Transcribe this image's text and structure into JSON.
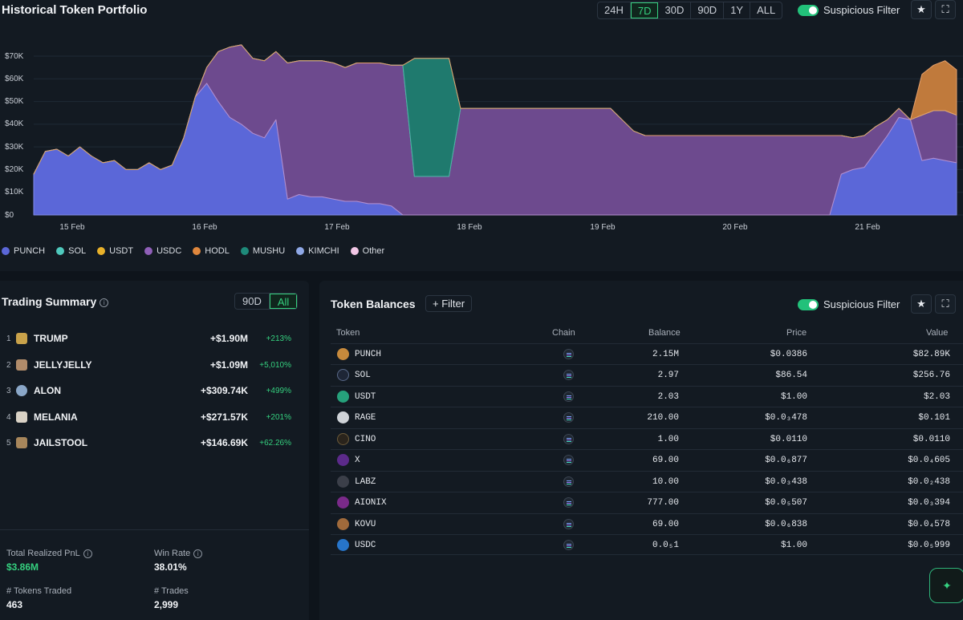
{
  "chart": {
    "title": "Historical Token Portfolio",
    "ranges": [
      "24H",
      "7D",
      "30D",
      "90D",
      "1Y",
      "ALL"
    ],
    "active_range": "7D",
    "suspicious_filter_label": "Suspicious Filter",
    "y_ticks": [
      "$70K",
      "$60K",
      "$50K",
      "$40K",
      "$30K",
      "$20K",
      "$10K",
      "$0"
    ],
    "x_ticks": [
      "15 Feb",
      "16 Feb",
      "17 Feb",
      "18 Feb",
      "19 Feb",
      "20 Feb",
      "21 Feb"
    ],
    "legend": [
      {
        "label": "PUNCH",
        "color": "#5b67d8"
      },
      {
        "label": "SOL",
        "color": "#4fc9bd"
      },
      {
        "label": "USDT",
        "color": "#e8b12a"
      },
      {
        "label": "USDC",
        "color": "#8f5fb8"
      },
      {
        "label": "HODL",
        "color": "#e0873d"
      },
      {
        "label": "MUSHU",
        "color": "#1e8a7a"
      },
      {
        "label": "KIMCHI",
        "color": "#8fa8e6"
      },
      {
        "label": "Other",
        "color": "#f2c7e6"
      }
    ]
  },
  "chart_data": {
    "type": "area",
    "x": [
      0,
      0.5,
      1,
      1.5,
      2,
      2.5,
      3,
      3.5,
      4,
      4.5,
      5,
      5.5,
      6,
      6.5,
      7,
      7.5,
      8,
      8.5,
      9,
      9.5,
      10,
      10.5,
      11,
      11.5,
      12,
      12.5,
      13,
      13.5,
      14,
      14.5,
      15,
      15.5,
      16,
      16.5,
      17,
      17.5,
      18,
      18.5,
      19,
      19.5,
      20,
      20.5,
      21,
      21.5,
      22,
      22.5,
      23,
      23.5,
      24,
      24.5,
      25,
      25.5,
      26,
      26.5,
      27,
      27.5,
      28,
      28.5,
      29,
      29.5,
      30,
      30.5,
      31,
      31.5,
      32,
      32.5,
      33,
      33.5,
      34,
      34.5,
      35,
      35.5,
      36,
      36.5,
      37,
      37.5,
      38,
      38.5,
      39,
      39.5,
      40
    ],
    "x_unit": "position within 7D window (Feb 14 → Feb 21)",
    "series": [
      {
        "name": "PUNCH",
        "values": [
          18,
          28,
          29,
          26,
          30,
          26,
          23,
          24,
          20,
          20,
          23,
          20,
          22,
          34,
          52,
          58,
          50,
          43,
          40,
          36,
          34,
          42,
          7,
          9,
          8,
          8,
          7,
          6,
          6,
          5,
          5,
          4,
          0,
          0,
          0,
          0,
          0,
          0,
          0,
          0,
          0,
          0,
          0,
          0,
          0,
          0,
          0,
          0,
          0,
          0,
          0,
          0,
          0,
          0,
          0,
          0,
          0,
          0,
          0,
          0,
          0,
          0,
          0,
          0,
          0,
          0,
          0,
          0,
          0,
          0,
          18,
          20,
          21,
          28,
          35,
          43,
          42,
          24,
          25,
          24,
          23
        ]
      },
      {
        "name": "USDC",
        "values": [
          0,
          0,
          0,
          0,
          0,
          0,
          0,
          0,
          0,
          0,
          0,
          0,
          0,
          0,
          0,
          7,
          22,
          31,
          35,
          33,
          34,
          30,
          60,
          59,
          60,
          60,
          60,
          59,
          61,
          62,
          62,
          62,
          66,
          17,
          17,
          17,
          17,
          47,
          47,
          47,
          47,
          47,
          47,
          47,
          47,
          47,
          47,
          47,
          47,
          47,
          47,
          42,
          37,
          35,
          35,
          35,
          35,
          35,
          35,
          35,
          35,
          35,
          35,
          35,
          35,
          35,
          35,
          35,
          35,
          35,
          17,
          14,
          14,
          11,
          7,
          4,
          0,
          20,
          21,
          22,
          21
        ]
      },
      {
        "name": "MUSHU",
        "values": [
          0,
          0,
          0,
          0,
          0,
          0,
          0,
          0,
          0,
          0,
          0,
          0,
          0,
          0,
          0,
          0,
          0,
          0,
          0,
          0,
          0,
          0,
          0,
          0,
          0,
          0,
          0,
          0,
          0,
          0,
          0,
          0,
          0,
          52,
          52,
          52,
          52,
          0,
          0,
          0,
          0,
          0,
          0,
          0,
          0,
          0,
          0,
          0,
          0,
          0,
          0,
          0,
          0,
          0,
          0,
          0,
          0,
          0,
          0,
          0,
          0,
          0,
          0,
          0,
          0,
          0,
          0,
          0,
          0,
          0,
          0,
          0,
          0,
          0,
          0,
          0,
          0,
          0,
          0,
          0,
          0
        ]
      },
      {
        "name": "HODL",
        "values": [
          0,
          0,
          0,
          0,
          0,
          0,
          0,
          0,
          0,
          0,
          0,
          0,
          0,
          0,
          0,
          0,
          0,
          0,
          0,
          0,
          0,
          0,
          0,
          0,
          0,
          0,
          0,
          0,
          0,
          0,
          0,
          0,
          0,
          0,
          0,
          0,
          0,
          0,
          0,
          0,
          0,
          0,
          0,
          0,
          0,
          0,
          0,
          0,
          0,
          0,
          0,
          0,
          0,
          0,
          0,
          0,
          0,
          0,
          0,
          0,
          0,
          0,
          0,
          0,
          0,
          0,
          0,
          0,
          0,
          0,
          0,
          0,
          0,
          0,
          0,
          0,
          0,
          18,
          20,
          22,
          20
        ]
      }
    ],
    "ylim": [
      0,
      75
    ],
    "y_unit": "$K",
    "x_ticks": [
      "15 Feb",
      "16 Feb",
      "17 Feb",
      "18 Feb",
      "19 Feb",
      "20 Feb",
      "21 Feb"
    ],
    "y_ticks": [
      "$0",
      "$10K",
      "$20K",
      "$30K",
      "$40K",
      "$50K",
      "$60K",
      "$70K"
    ]
  },
  "trading": {
    "title": "Trading Summary",
    "toggle": [
      "90D",
      "All"
    ],
    "active_toggle": "All",
    "rows": [
      {
        "rank": "1",
        "name": "TRUMP",
        "pnl": "+$1.90M",
        "pct": "+213%",
        "color": "#c9a24a"
      },
      {
        "rank": "2",
        "name": "JELLYJELLY",
        "pnl": "+$1.09M",
        "pct": "+5,010%",
        "color": "#b08b6a"
      },
      {
        "rank": "3",
        "name": "ALON",
        "pnl": "+$309.74K",
        "pct": "+499%",
        "color": "#8aa7c8"
      },
      {
        "rank": "4",
        "name": "MELANIA",
        "pnl": "+$271.57K",
        "pct": "+201%",
        "color": "#d9d2c6"
      },
      {
        "rank": "5",
        "name": "JAILSTOOL",
        "pnl": "+$146.69K",
        "pct": "+62.26%",
        "color": "#a7865b"
      }
    ],
    "stats": {
      "realized_label": "Total Realized PnL",
      "realized_value": "$3.86M",
      "winrate_label": "Win Rate",
      "winrate_value": "38.01%",
      "tokens_label": "# Tokens Traded",
      "tokens_value": "463",
      "trades_label": "# Trades",
      "trades_value": "2,999"
    }
  },
  "balances": {
    "title": "Token Balances",
    "filter_label": "+ Filter",
    "suspicious_filter_label": "Suspicious Filter",
    "columns": [
      "Token",
      "Chain",
      "Balance",
      "Price",
      "Value"
    ],
    "rows": [
      {
        "token": "PUNCH",
        "balance": "2.15M",
        "price": "$0.0386",
        "value": "$82.89K",
        "color": "#c78a3c"
      },
      {
        "token": "SOL",
        "balance": "2.97",
        "price": "$86.54",
        "value": "$256.76",
        "color": "#1e2636"
      },
      {
        "token": "USDT",
        "balance": "2.03",
        "price": "$1.00",
        "value": "$2.03",
        "color": "#26a17b"
      },
      {
        "token": "RAGE",
        "balance": "210.00",
        "price": "$0.0₃478",
        "value": "$0.101",
        "color": "#cfd3d8"
      },
      {
        "token": "CINO",
        "balance": "1.00",
        "price": "$0.0110",
        "value": "$0.0110",
        "color": "#2a241c"
      },
      {
        "token": "X",
        "balance": "69.00",
        "price": "$0.0₆877",
        "value": "$0.0₄605",
        "color": "#5b2a8a"
      },
      {
        "token": "LABZ",
        "balance": "10.00",
        "price": "$0.0₃438",
        "value": "$0.0₂438",
        "color": "#3b3f49"
      },
      {
        "token": "AIONIX",
        "balance": "777.00",
        "price": "$0.0₅507",
        "value": "$0.0₃394",
        "color": "#7a2a8a"
      },
      {
        "token": "KOVU",
        "balance": "69.00",
        "price": "$0.0₆838",
        "value": "$0.0₄578",
        "color": "#a06a3b"
      },
      {
        "token": "USDC",
        "balance": "0.0₅1",
        "price": "$1.00",
        "value": "$0.0₅999",
        "color": "#2775ca"
      }
    ]
  }
}
